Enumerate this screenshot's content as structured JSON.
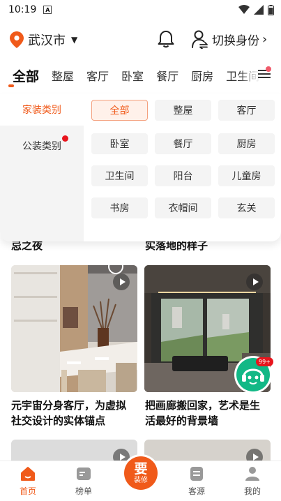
{
  "status_bar": {
    "time": "10:19",
    "sim_label": "A"
  },
  "header": {
    "city": "武汉市",
    "identity_label": "切换身份"
  },
  "tabs": [
    "全部",
    "整屋",
    "客厅",
    "卧室",
    "餐厅",
    "厨房",
    "卫生间"
  ],
  "categories": {
    "home": "家装类别",
    "commercial": "公装类别"
  },
  "room_chips": [
    "全部",
    "整屋",
    "客厅",
    "卧室",
    "餐厅",
    "厨房",
    "卫生间",
    "阳台",
    "儿童房",
    "书房",
    "衣帽间",
    "玄关"
  ],
  "feed": {
    "partial_left": "忌之夜",
    "partial_right": "实落地的样子",
    "card1_title_l1": "元宇宙分身客厅，为虚拟",
    "card1_title_l2": "社交设计的实体锚点",
    "card2_title_l1": "把画廊搬回家，艺术是生",
    "card2_title_l2": "活最好的背景墙"
  },
  "service_badge": "99+",
  "publish": {
    "main": "要",
    "sub": "装修"
  },
  "bottom_nav": [
    "首页",
    "榜单",
    "客源",
    "我的"
  ],
  "colors": {
    "accent": "#f05a1a",
    "badge": "#e8151d",
    "service": "#12b886"
  }
}
